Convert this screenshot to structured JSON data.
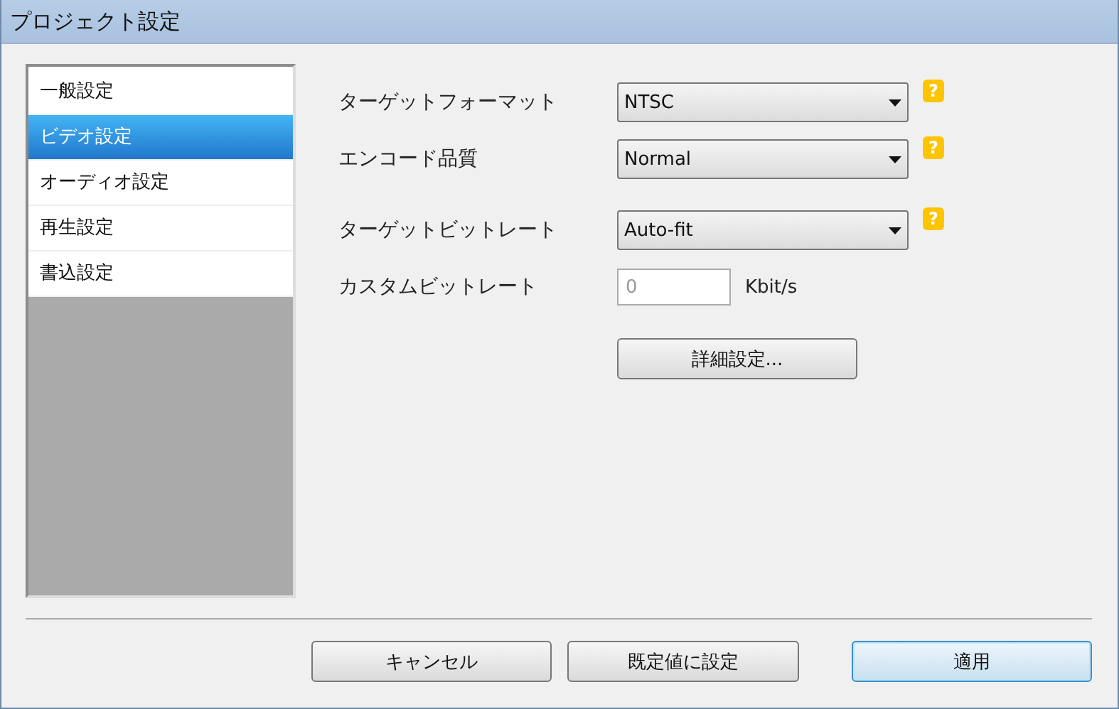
{
  "window": {
    "title": "プロジェクト設定"
  },
  "sidebar": {
    "items": [
      {
        "label": "一般設定",
        "selected": false
      },
      {
        "label": "ビデオ設定",
        "selected": true
      },
      {
        "label": "オーディオ設定",
        "selected": false
      },
      {
        "label": "再生設定",
        "selected": false
      },
      {
        "label": "書込設定",
        "selected": false
      }
    ]
  },
  "settings": [
    {
      "kind": "dropdown",
      "label": "ターゲットフォーマット",
      "value": "NTSC",
      "help": "?"
    },
    {
      "kind": "dropdown",
      "label": "エンコード品質",
      "value": "Normal",
      "help": "?"
    },
    {
      "kind": "dropdown",
      "label": "ターゲットビットレート",
      "value": "Auto-fit",
      "help": "?"
    },
    {
      "kind": "input",
      "label": "カスタムビットレート",
      "value": "0",
      "unit": "Kbit/s",
      "disabled": true
    }
  ],
  "advanced_button": "詳細設定...",
  "buttons": [
    {
      "label": "キャンセル",
      "default": false
    },
    {
      "label": "既定値に設定",
      "default": false
    },
    {
      "label": "適用",
      "default": true
    }
  ]
}
